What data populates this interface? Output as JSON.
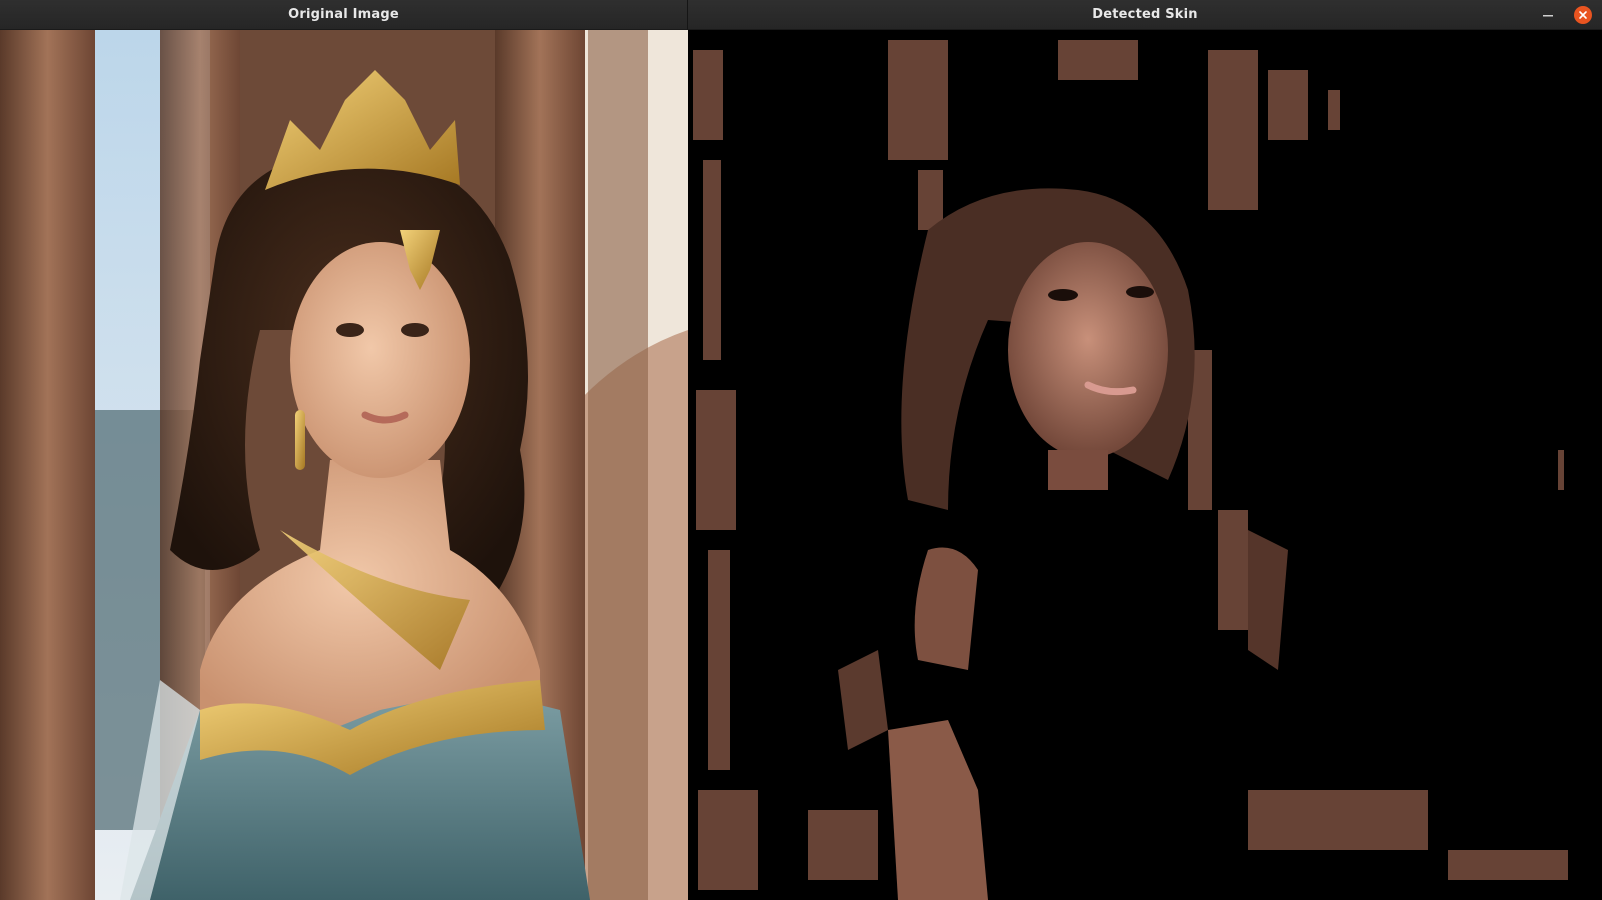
{
  "windows": [
    {
      "title": "Original Image"
    },
    {
      "title": "Detected Skin"
    }
  ],
  "icons": {
    "minimize": "minimize-icon",
    "close": "close-icon"
  },
  "colors": {
    "titlebar": "#2b2b2b",
    "title_text": "#e8e8e8",
    "close_accent": "#e95420",
    "mask_background": "#000000",
    "skin_tone": "#a07060"
  }
}
